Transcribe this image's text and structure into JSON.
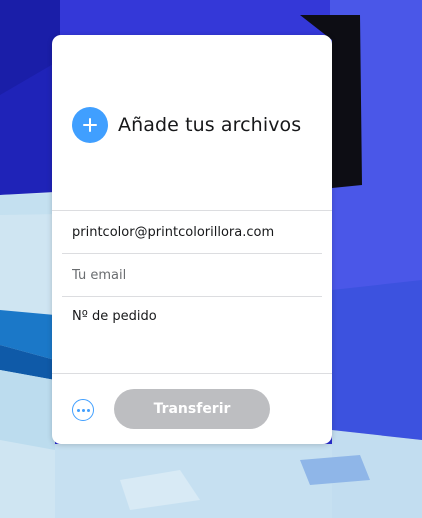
{
  "upload": {
    "add_files_label": "Añade tus archivos",
    "add_icon": "plus-icon"
  },
  "form": {
    "recipient_value": "printcolor@printcolorillora.com",
    "sender_placeholder": "Tu email",
    "message_placeholder": "Nº de pedido"
  },
  "footer": {
    "more_icon": "more-options-icon",
    "transfer_label": "Transferir"
  },
  "colors": {
    "accent": "#409fff",
    "disabled_button": "#bdbec1",
    "background_blue": "#2a2fd0",
    "background_light": "#c8e2f0"
  }
}
